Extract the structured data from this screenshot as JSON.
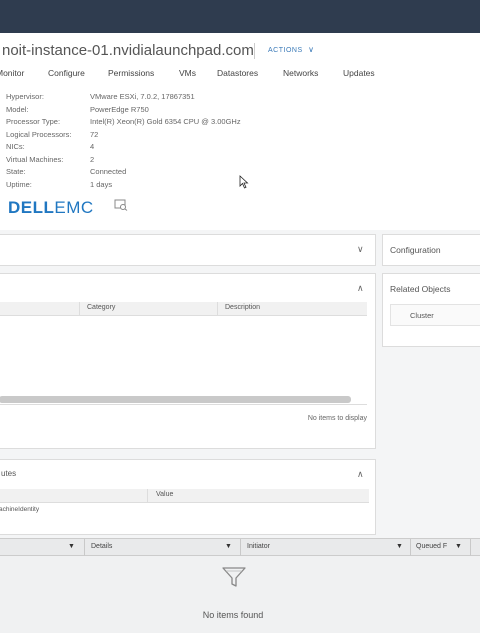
{
  "header": {
    "host_title": "noit-instance-01.nvidialaunchpad.com",
    "actions_label": "ACTIONS"
  },
  "tabs": [
    "Monitor",
    "Configure",
    "Permissions",
    "VMs",
    "Datastores",
    "Networks",
    "Updates"
  ],
  "summary": {
    "rows": [
      {
        "key": "Hypervisor:",
        "value": "VMware ESXi, 7.0.2, 17867351"
      },
      {
        "key": "Model:",
        "value": "PowerEdge R750"
      },
      {
        "key": "Processor Type:",
        "value": "Intel(R) Xeon(R) Gold 6354 CPU @ 3.00GHz"
      },
      {
        "key": "Logical Processors:",
        "value": "72"
      },
      {
        "key": "NICs:",
        "value": "4"
      },
      {
        "key": "Virtual Machines:",
        "value": "2"
      },
      {
        "key": "State:",
        "value": "Connected"
      },
      {
        "key": "Uptime:",
        "value": "1 days"
      }
    ],
    "vendor_logo": {
      "dell": "DELL",
      "emc": "EMC"
    }
  },
  "panels": {
    "configuration_title": "Configuration",
    "related_objects_title": "Related Objects",
    "cluster_label": "Cluster",
    "tags_grid": {
      "columns": [
        "Category",
        "Description"
      ],
      "empty_text": "No items to display"
    },
    "attributes": {
      "title_fragment": "utes",
      "columns": [
        "Value"
      ],
      "row_fragment": "achineIdentity"
    }
  },
  "tasks": {
    "columns": [
      "Details",
      "Initiator",
      "Queued F"
    ],
    "empty_text": "No items found"
  },
  "colors": {
    "topbar": "#2f3c4f",
    "accent": "#3b7ab8",
    "dell_blue": "#2077c1"
  },
  "icons": [
    "chevron-down-icon",
    "chevron-up-icon",
    "filter-icon",
    "funnel-icon",
    "vendor-hardware-icon",
    "mouse-cursor-icon"
  ]
}
